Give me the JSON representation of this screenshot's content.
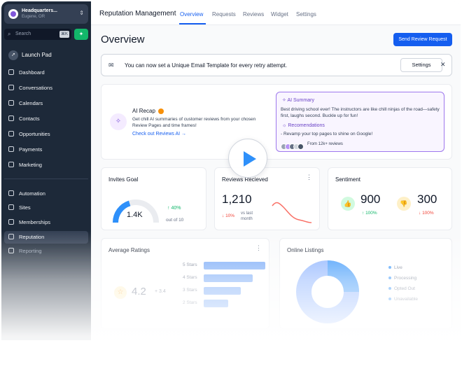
{
  "account": {
    "name": "Headquarters...",
    "location": "Eugene, OR"
  },
  "search": {
    "placeholder": "Search",
    "shortcut": "⌘K"
  },
  "sidebar": {
    "launch": "Launch Pad",
    "items": [
      {
        "label": "Dashboard"
      },
      {
        "label": "Conversations"
      },
      {
        "label": "Calendars"
      },
      {
        "label": "Contacts"
      },
      {
        "label": "Opportunities"
      },
      {
        "label": "Payments"
      },
      {
        "label": "Marketing"
      }
    ],
    "items2": [
      {
        "label": "Automation"
      },
      {
        "label": "Sites"
      },
      {
        "label": "Memberships"
      },
      {
        "label": "Reputation"
      },
      {
        "label": "Reporting"
      }
    ]
  },
  "header": {
    "title": "Reputation Management",
    "tabs": [
      "Overview",
      "Requests",
      "Reviews",
      "Widget",
      "Settings"
    ]
  },
  "page": {
    "title": "Overview",
    "send_button": "Send  Review Request"
  },
  "banner": {
    "message": "You can now set a Unique Email Template for every retry attempt.",
    "settings_button": "Settings"
  },
  "recap": {
    "title": "AI Recap",
    "desc": "Get chill AI summaries of customer reviews from your chosen Review Pages and time frames!",
    "link": "Check out Reviews AI",
    "summary_title": "AI Summary",
    "summary_body": "Best driving school ever! The instructors are like chill ninjas of the road—safety first, laughs second. Buckle up for fun!",
    "recs_title": "Recomendations",
    "recs_body": "- Revamp your top pages to shine on Google!",
    "from": "From 12k+ reviews"
  },
  "invites": {
    "title": "Invites Goal",
    "value": "1.4K",
    "pct": "40%",
    "out": "out of 10",
    "progress": 0.4
  },
  "reviews_card": {
    "title": "Reviews Recieved",
    "value": "1,210",
    "pct": "10%",
    "vs": "vs last month"
  },
  "sentiment": {
    "title": "Sentiment",
    "positive": "900",
    "positive_pct": "100%",
    "negative": "300",
    "negative_pct": "100%"
  },
  "ratings": {
    "title": "Average Ratings",
    "value": "4.2",
    "delta": "+ 3.4",
    "bars": [
      {
        "label": "5 Stars",
        "value": 1.0
      },
      {
        "label": "4 Stars",
        "value": 0.8
      },
      {
        "label": "3 Stars",
        "value": 0.6
      },
      {
        "label": "2 Stars",
        "value": 0.4
      }
    ]
  },
  "listings": {
    "title": "Online Listings",
    "legend": [
      "Live",
      "Processing",
      "Opted Out",
      "Unavailable"
    ]
  },
  "colors": {
    "accent": "#155eef",
    "sidebar": "#1d2939",
    "purple": "#7f56d9",
    "green": "#12b76a",
    "red": "#f04438"
  }
}
